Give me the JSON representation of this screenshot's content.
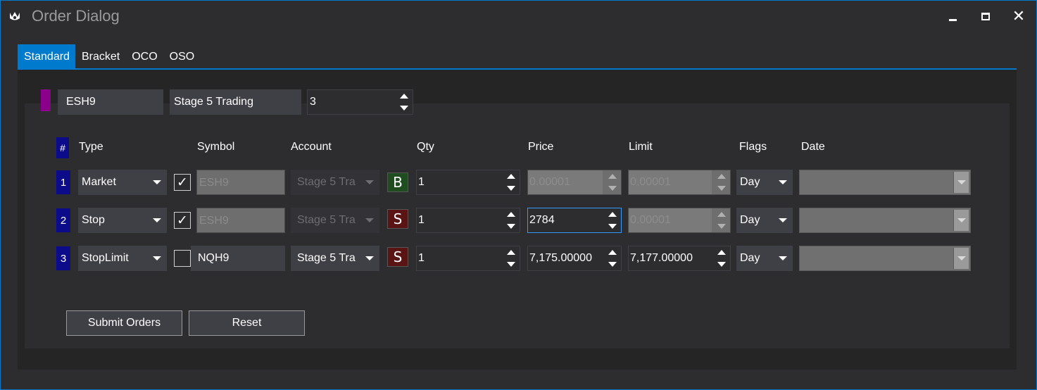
{
  "window": {
    "title": "Order Dialog"
  },
  "tabs": [
    {
      "label": "Standard",
      "active": true
    },
    {
      "label": "Bracket",
      "active": false
    },
    {
      "label": "OCO",
      "active": false
    },
    {
      "label": "OSO",
      "active": false
    }
  ],
  "header": {
    "symbol": "ESH9",
    "account": "Stage 5 Trading",
    "quantity": "3",
    "color": "#8b008b"
  },
  "columns": {
    "num": "#",
    "type": "Type",
    "symbol": "Symbol",
    "account": "Account",
    "qty": "Qty",
    "price": "Price",
    "limit": "Limit",
    "flags": "Flags",
    "date": "Date"
  },
  "orders": [
    {
      "num": "1",
      "type": "Market",
      "checked": true,
      "check_glyph": "✓",
      "symbol": "ESH9",
      "account": "Stage 5 Tra",
      "side": "B",
      "qty": "1",
      "price": "0.00001",
      "limit": "0.00001",
      "flags": "Day",
      "date": ""
    },
    {
      "num": "2",
      "type": "Stop",
      "checked": true,
      "check_glyph": "✓",
      "symbol": "ESH9",
      "account": "Stage 5 Tra",
      "side": "S",
      "qty": "1",
      "price": "2784",
      "limit": "0.00001",
      "flags": "Day",
      "date": ""
    },
    {
      "num": "3",
      "type": "StopLimit",
      "checked": false,
      "check_glyph": "",
      "symbol": "NQH9",
      "account": "Stage 5 Tra",
      "side": "S",
      "qty": "1",
      "price": "7,175.00000",
      "limit": "7,177.00000",
      "flags": "Day",
      "date": ""
    }
  ],
  "buttons": {
    "submit": "Submit Orders",
    "reset": "Reset"
  },
  "colors": {
    "accent": "#007acc",
    "buy": "#1f4d1f",
    "sell": "#5a1414",
    "row_badge": "#0c0c8a"
  }
}
